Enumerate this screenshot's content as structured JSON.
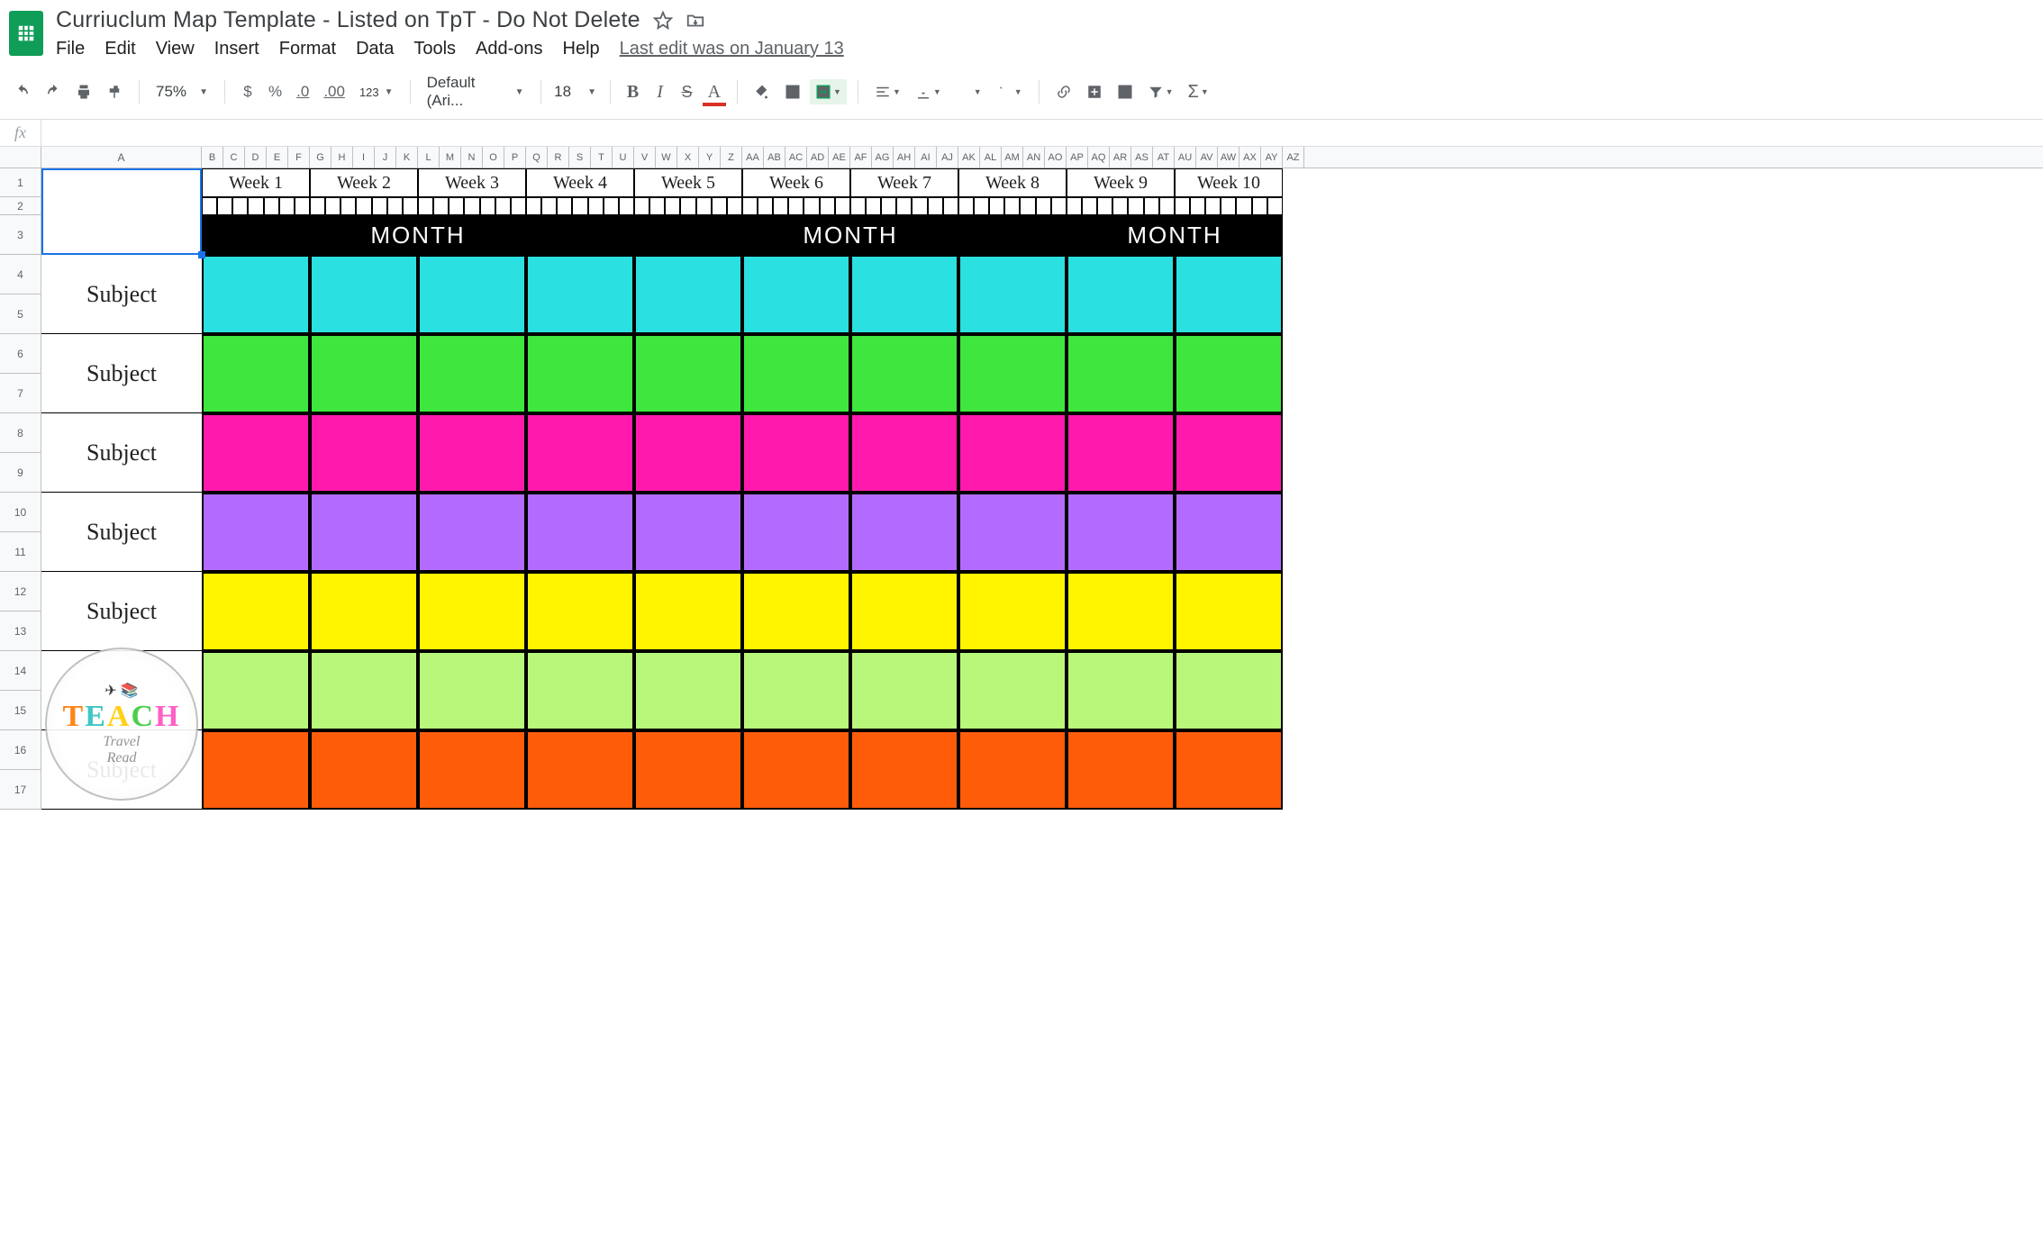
{
  "header": {
    "title": "Curriuclum Map Template - Listed on TpT - Do Not Delete",
    "menus": [
      "File",
      "Edit",
      "View",
      "Insert",
      "Format",
      "Data",
      "Tools",
      "Add-ons",
      "Help"
    ],
    "last_edit": "Last edit was on January 13"
  },
  "toolbar": {
    "zoom": "75%",
    "currency": "$",
    "percent": "%",
    "dec_dec": ".0",
    "dec_inc": ".00",
    "numfmt": "123",
    "font": "Default (Ari...",
    "size": "18",
    "bold": "B",
    "italic": "I",
    "strike": "S",
    "textcolor": "A",
    "sigma": "Σ"
  },
  "fx": {
    "label": "fx",
    "value": ""
  },
  "columns": {
    "A": "A",
    "small": [
      "B",
      "C",
      "D",
      "E",
      "F",
      "G",
      "H",
      "I",
      "J",
      "K",
      "L",
      "M",
      "N",
      "O",
      "P",
      "Q",
      "R",
      "S",
      "T",
      "U",
      "V",
      "W",
      "X",
      "Y",
      "Z",
      "AA",
      "AB",
      "AC",
      "AD",
      "AE",
      "AF",
      "AG",
      "AH",
      "AI",
      "AJ",
      "AK",
      "AL",
      "AM",
      "AN",
      "AO",
      "AP",
      "AQ",
      "AR",
      "AS",
      "AT",
      "AU",
      "AV",
      "AW",
      "AX",
      "AY",
      "AZ"
    ]
  },
  "rows": [
    "1",
    "2",
    "3",
    "4",
    "5",
    "6",
    "7",
    "8",
    "9",
    "10",
    "11",
    "12",
    "13",
    "14",
    "15",
    "16",
    "17"
  ],
  "weeks": [
    "Week 1",
    "Week 2",
    "Week 3",
    "Week 4",
    "Week 5",
    "Week 6",
    "Week 7",
    "Week 8",
    "Week 9",
    "Week 10"
  ],
  "month_label": "MONTH",
  "month_spans": [
    4,
    4,
    2
  ],
  "subjects": [
    {
      "label": "Subject",
      "color": "c-cyan"
    },
    {
      "label": "Subject",
      "color": "c-green"
    },
    {
      "label": "Subject",
      "color": "c-magenta"
    },
    {
      "label": "Subject",
      "color": "c-purple"
    },
    {
      "label": "Subject",
      "color": "c-yellow"
    },
    {
      "label": "",
      "color": "c-lime"
    },
    {
      "label": "Subject",
      "color": "c-orange"
    }
  ],
  "watermark": {
    "teach": "TEACH",
    "travel": "Travel",
    "read": "Read"
  }
}
